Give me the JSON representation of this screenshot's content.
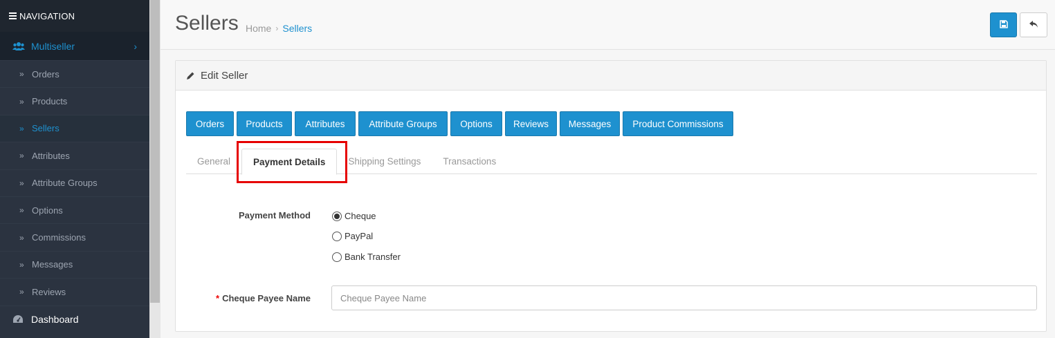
{
  "sidebar": {
    "header": "NAVIGATION",
    "parent": {
      "label": "Multiseller"
    },
    "items": [
      {
        "label": "Orders"
      },
      {
        "label": "Products"
      },
      {
        "label": "Sellers"
      },
      {
        "label": "Attributes"
      },
      {
        "label": "Attribute Groups"
      },
      {
        "label": "Options"
      },
      {
        "label": "Commissions"
      },
      {
        "label": "Messages"
      },
      {
        "label": "Reviews"
      }
    ],
    "dashboard": {
      "label": "Dashboard"
    }
  },
  "header": {
    "title": "Sellers",
    "breadcrumb": [
      "Home",
      "Sellers"
    ]
  },
  "panel": {
    "title": "Edit Seller",
    "buttons": [
      "Orders",
      "Products",
      "Attributes",
      "Attribute Groups",
      "Options",
      "Reviews",
      "Messages",
      "Product Commissions"
    ],
    "tabs": [
      "General",
      "Payment Details",
      "Shipping Settings",
      "Transactions"
    ],
    "active_tab": "Payment Details"
  },
  "form": {
    "payment_method_label": "Payment Method",
    "methods": [
      {
        "label": "Cheque",
        "checked": true
      },
      {
        "label": "PayPal",
        "checked": false
      },
      {
        "label": "Bank Transfer",
        "checked": false
      }
    ],
    "required_mark": "*",
    "payee_label": "Cheque Payee Name",
    "payee_placeholder": "Cheque Payee Name",
    "payee_value": ""
  },
  "colors": {
    "accent": "#1e91cf",
    "sidebar": "#2b3340",
    "highlight": "#e60000"
  }
}
